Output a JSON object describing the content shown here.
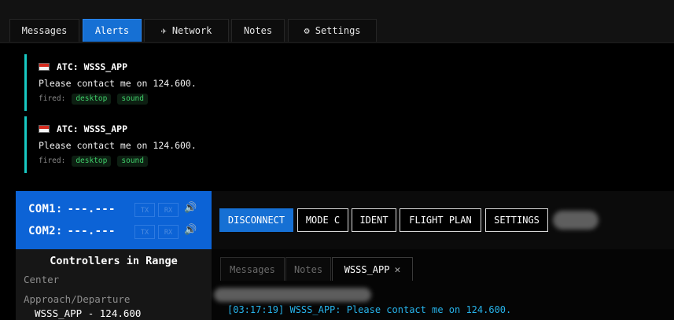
{
  "top_tabs": [
    {
      "label": "Messages",
      "active": false
    },
    {
      "label": "Alerts",
      "active": true
    },
    {
      "label": "Network",
      "icon": "airplane-icon",
      "active": false
    },
    {
      "label": "Notes",
      "active": false
    },
    {
      "label": "Settings",
      "icon": "gear-icon",
      "active": false
    }
  ],
  "alerts": [
    {
      "title": "ATC: WSSS_APP",
      "message": "Please contact me on 124.600.",
      "fired_label": "fired:",
      "channels": [
        "desktop",
        "sound"
      ]
    },
    {
      "title": "ATC: WSSS_APP",
      "message": "Please contact me on 124.600.",
      "fired_label": "fired:",
      "channels": [
        "desktop",
        "sound"
      ]
    }
  ],
  "radios": [
    {
      "label": "COM1:",
      "frequency": "---.---",
      "tx": "TX",
      "rx": "RX"
    },
    {
      "label": "COM2:",
      "frequency": "---.---",
      "tx": "TX",
      "rx": "RX"
    }
  ],
  "buttons": {
    "disconnect": "DISCONNECT",
    "mode": "MODE C",
    "ident": "IDENT",
    "flight_plan": "FLIGHT PLAN",
    "settings": "SETTINGS"
  },
  "controllers": {
    "title": "Controllers in Range",
    "categories": [
      "Center",
      "Approach/Departure"
    ],
    "entries": [
      "WSSS_APP - 124.600"
    ]
  },
  "chat_tabs": [
    {
      "label": "Messages",
      "active": false
    },
    {
      "label": "Notes",
      "active": false
    },
    {
      "label": "WSSS_APP",
      "active": true,
      "closable": true
    }
  ],
  "chat_messages": [
    {
      "time": "[03:17:19]",
      "text": "WSSS_APP: Please contact me on 124.600."
    }
  ],
  "colors": {
    "accent": "#1670d4",
    "alert_border": "#18c9c3",
    "chip_text": "#3fd06a",
    "chat_text": "#27b3ea"
  }
}
